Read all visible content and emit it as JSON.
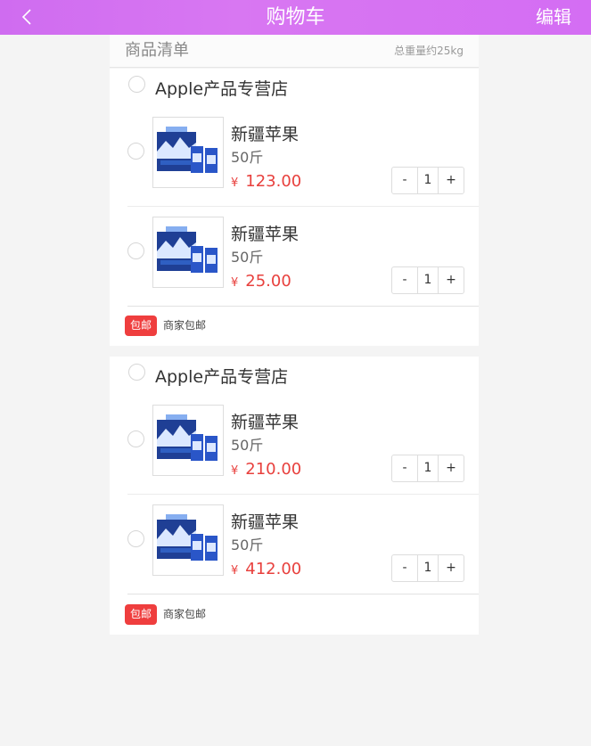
{
  "header": {
    "title": "购物车",
    "edit_label": "编辑",
    "back_icon": "chevron-left-icon"
  },
  "summary": {
    "label": "商品清单",
    "weight": "总重量约25kg"
  },
  "shops": [
    {
      "name": "Apple产品专营店",
      "items": [
        {
          "name": "新疆苹果",
          "spec": "50斤",
          "currency": "¥",
          "price": "123.00",
          "quantity": "1"
        },
        {
          "name": "新疆苹果",
          "spec": "50斤",
          "currency": "¥",
          "price": "25.00",
          "quantity": "1"
        }
      ],
      "shipping_badge": "包邮",
      "shipping_text": "商家包邮"
    },
    {
      "name": "Apple产品专营店",
      "items": [
        {
          "name": "新疆苹果",
          "spec": "50斤",
          "currency": "¥",
          "price": "210.00",
          "quantity": "1"
        },
        {
          "name": "新疆苹果",
          "spec": "50斤",
          "currency": "¥",
          "price": "412.00",
          "quantity": "1"
        }
      ],
      "shipping_badge": "包邮",
      "shipping_text": "商家包邮"
    }
  ],
  "stepper": {
    "minus": "-",
    "plus": "+"
  },
  "colors": {
    "header_gradient_start": "#cf6cf0",
    "header_gradient_end": "#d46df3",
    "price": "#e8403d",
    "badge": "#ef3e3e"
  }
}
